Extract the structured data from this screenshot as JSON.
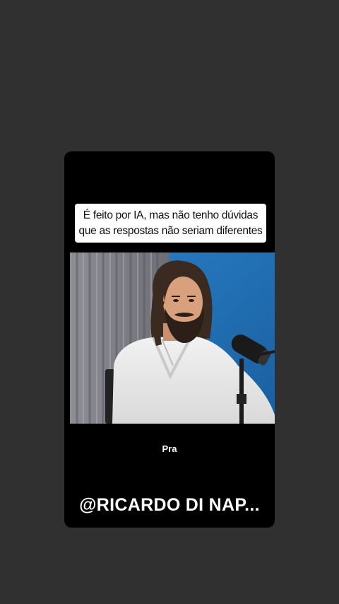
{
  "story": {
    "caption_line1": "É feito por IA, mas não tenho dúvidas",
    "caption_line2": "que as respostas não seriam diferentes",
    "subtitle": "Pra",
    "handle": "@RICARDO DI NAP..."
  },
  "colors": {
    "background": "#303030",
    "card": "#000000",
    "caption_bg": "#ffffff",
    "video_wall": "#1f6fb8"
  }
}
